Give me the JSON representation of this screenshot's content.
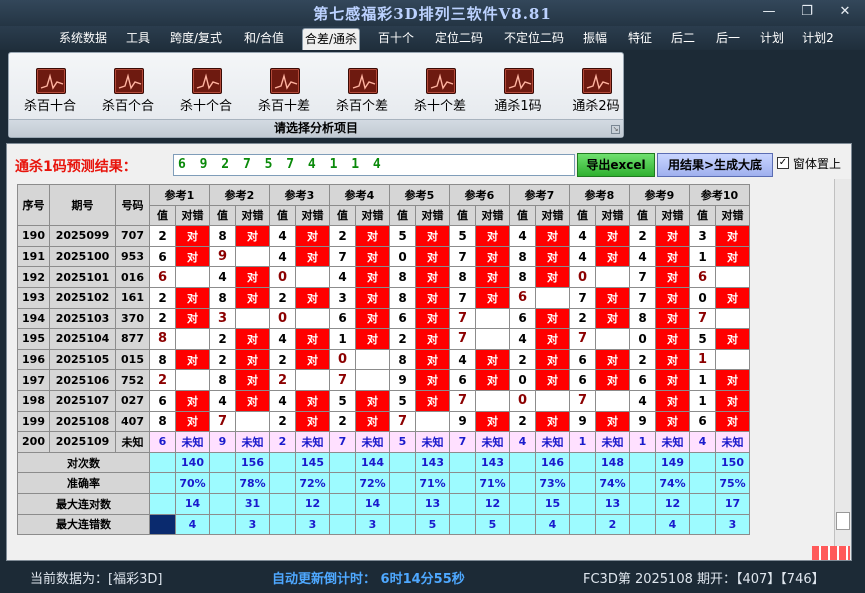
{
  "window": {
    "title": "第七感福彩3D排列三软件V8.81"
  },
  "menu": [
    "系统数据",
    "工具",
    "跨度/复式",
    "和/合值",
    "合差/通杀",
    "百十个",
    "定位二码",
    "不定位二码",
    "振幅",
    "特征",
    "后二",
    "后一",
    "计划",
    "计划2"
  ],
  "active_menu": "合差/通杀",
  "ribbon": {
    "buttons": [
      "杀百十合",
      "杀百个合",
      "杀十个合",
      "杀百十差",
      "杀百个差",
      "杀十个差",
      "通杀1码",
      "通杀2码"
    ],
    "caption": "请选择分析项目"
  },
  "prediction": {
    "label": "通杀1码预测结果：",
    "value": "6 9 2 7 5 7 4 1 1 4",
    "excel_button": "导出excel",
    "generate_button": "用结果>生成大底",
    "ontop_checked": true,
    "ontop_label": "窗体置上"
  },
  "table": {
    "col_seq": "序号",
    "col_issue": "期号",
    "col_num": "号码",
    "refs": [
      "参考1",
      "参考2",
      "参考3",
      "参考4",
      "参考5",
      "参考6",
      "参考7",
      "参考8",
      "参考9",
      "参考10"
    ],
    "sub_val": "值",
    "sub_flag": "对错",
    "hit_text": "对",
    "rows": [
      {
        "seq": "190",
        "issue": "2025099",
        "num": "707",
        "cells": [
          [
            "2",
            1
          ],
          [
            "8",
            1
          ],
          [
            "4",
            1
          ],
          [
            "2",
            1
          ],
          [
            "5",
            1
          ],
          [
            "5",
            1
          ],
          [
            "4",
            1
          ],
          [
            "4",
            1
          ],
          [
            "2",
            1
          ],
          [
            "3",
            1
          ]
        ]
      },
      {
        "seq": "191",
        "issue": "2025100",
        "num": "953",
        "cells": [
          [
            "6",
            1
          ],
          [
            "9",
            0
          ],
          [
            "4",
            1
          ],
          [
            "7",
            1
          ],
          [
            "0",
            1
          ],
          [
            "7",
            1
          ],
          [
            "8",
            1
          ],
          [
            "4",
            1
          ],
          [
            "4",
            1
          ],
          [
            "1",
            1
          ]
        ]
      },
      {
        "seq": "192",
        "issue": "2025101",
        "num": "016",
        "cells": [
          [
            "6",
            0
          ],
          [
            "4",
            1
          ],
          [
            "0",
            0
          ],
          [
            "4",
            1
          ],
          [
            "8",
            1
          ],
          [
            "8",
            1
          ],
          [
            "8",
            1
          ],
          [
            "0",
            0
          ],
          [
            "7",
            1
          ],
          [
            "6",
            0
          ]
        ]
      },
      {
        "seq": "193",
        "issue": "2025102",
        "num": "161",
        "cells": [
          [
            "2",
            1
          ],
          [
            "8",
            1
          ],
          [
            "2",
            1
          ],
          [
            "3",
            1
          ],
          [
            "8",
            1
          ],
          [
            "7",
            1
          ],
          [
            "6",
            0
          ],
          [
            "7",
            1
          ],
          [
            "7",
            1
          ],
          [
            "0",
            1
          ]
        ]
      },
      {
        "seq": "194",
        "issue": "2025103",
        "num": "370",
        "cells": [
          [
            "2",
            1
          ],
          [
            "3",
            0
          ],
          [
            "0",
            0
          ],
          [
            "6",
            1
          ],
          [
            "6",
            1
          ],
          [
            "7",
            0
          ],
          [
            "6",
            1
          ],
          [
            "2",
            1
          ],
          [
            "8",
            1
          ],
          [
            "7",
            0
          ]
        ]
      },
      {
        "seq": "195",
        "issue": "2025104",
        "num": "877",
        "cells": [
          [
            "8",
            0
          ],
          [
            "2",
            1
          ],
          [
            "4",
            1
          ],
          [
            "1",
            1
          ],
          [
            "2",
            1
          ],
          [
            "7",
            0
          ],
          [
            "4",
            1
          ],
          [
            "7",
            0
          ],
          [
            "0",
            1
          ],
          [
            "5",
            1
          ]
        ]
      },
      {
        "seq": "196",
        "issue": "2025105",
        "num": "015",
        "cells": [
          [
            "8",
            1
          ],
          [
            "2",
            1
          ],
          [
            "2",
            1
          ],
          [
            "0",
            0
          ],
          [
            "8",
            1
          ],
          [
            "4",
            1
          ],
          [
            "2",
            1
          ],
          [
            "6",
            1
          ],
          [
            "2",
            1
          ],
          [
            "1",
            0
          ]
        ]
      },
      {
        "seq": "197",
        "issue": "2025106",
        "num": "752",
        "cells": [
          [
            "2",
            0
          ],
          [
            "8",
            1
          ],
          [
            "2",
            0
          ],
          [
            "7",
            0
          ],
          [
            "9",
            1
          ],
          [
            "6",
            1
          ],
          [
            "0",
            1
          ],
          [
            "6",
            1
          ],
          [
            "6",
            1
          ],
          [
            "1",
            1
          ]
        ]
      },
      {
        "seq": "198",
        "issue": "2025107",
        "num": "027",
        "cells": [
          [
            "6",
            1
          ],
          [
            "4",
            1
          ],
          [
            "4",
            1
          ],
          [
            "5",
            1
          ],
          [
            "5",
            1
          ],
          [
            "7",
            0
          ],
          [
            "0",
            0
          ],
          [
            "7",
            0
          ],
          [
            "4",
            1
          ],
          [
            "1",
            1
          ]
        ]
      },
      {
        "seq": "199",
        "issue": "2025108",
        "num": "407",
        "cells": [
          [
            "8",
            1
          ],
          [
            "7",
            0
          ],
          [
            "2",
            1
          ],
          [
            "2",
            1
          ],
          [
            "7",
            0
          ],
          [
            "9",
            1
          ],
          [
            "2",
            1
          ],
          [
            "9",
            1
          ],
          [
            "9",
            1
          ],
          [
            "6",
            1
          ]
        ]
      }
    ],
    "pred_row": {
      "seq": "200",
      "issue": "2025109",
      "num": "未知",
      "vals": [
        "6",
        "9",
        "2",
        "7",
        "5",
        "7",
        "4",
        "1",
        "1",
        "4"
      ],
      "flag": "未知"
    },
    "stats": [
      {
        "label": "对次数",
        "values": [
          "140",
          "156",
          "145",
          "144",
          "143",
          "143",
          "146",
          "148",
          "149",
          "150"
        ]
      },
      {
        "label": "准确率",
        "values": [
          "70%",
          "78%",
          "72%",
          "72%",
          "71%",
          "71%",
          "73%",
          "74%",
          "74%",
          "75%"
        ]
      },
      {
        "label": "最大连对数",
        "values": [
          "14",
          "31",
          "12",
          "14",
          "13",
          "12",
          "15",
          "13",
          "12",
          "17"
        ]
      },
      {
        "label": "最大连错数",
        "values": [
          "4",
          "3",
          "3",
          "3",
          "5",
          "5",
          "4",
          "2",
          "4",
          "3"
        ]
      }
    ]
  },
  "status": {
    "data_label": "当前数据为：[福彩3D]",
    "countdown": "自动更新倒计时： 6时14分55秒",
    "issue_info": "FC3D第 2025108 期开：【407】【746】"
  }
}
